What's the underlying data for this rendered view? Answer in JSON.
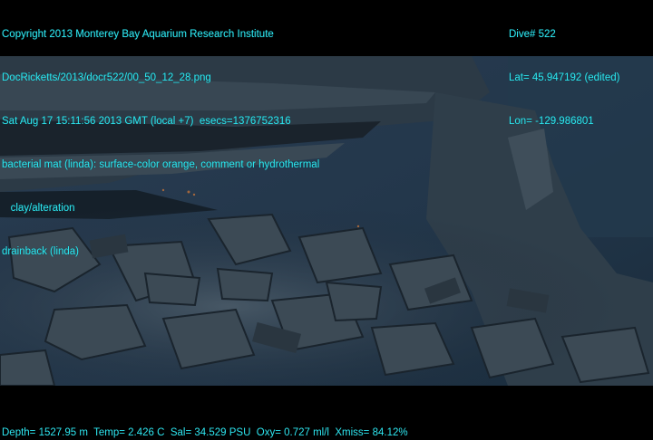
{
  "overlay_top_left": [
    "Copyright 2013 Monterey Bay Aquarium Research Institute",
    "DocRicketts/2013/docr522/00_50_12_28.png",
    "Sat Aug 17 15:11:56 2013 GMT (local +7)  esecs=1376752316",
    "bacterial mat (linda): surface-color orange, comment or hydrothermal",
    "   clay/alteration",
    "drainback (linda)"
  ],
  "overlay_top_right": [
    "Dive# 522",
    "Lat= 45.947192 (edited)",
    "Lon= -129.986801"
  ],
  "overlay_bottom": "Depth= 1527.95 m  Temp= 2.426 C  Sal= 34.529 PSU  Oxy= 0.727 ml/l  Xmiss= 84.12%",
  "colors": {
    "overlay_text": "#2ee6f0",
    "water": "#1f3347",
    "rock_dark": "#1b2530",
    "rock_light": "#4a5a66"
  }
}
